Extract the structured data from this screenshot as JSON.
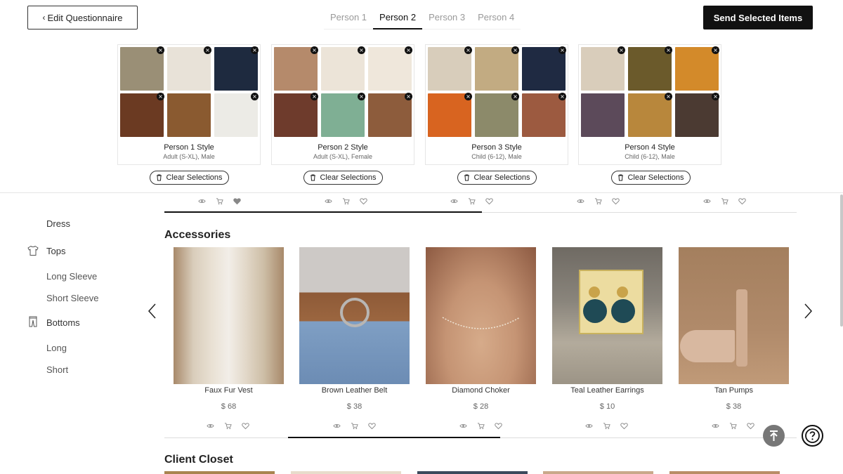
{
  "header": {
    "edit_label": "Edit Questionnaire",
    "send_label": "Send Selected Items",
    "tabs": [
      "Person 1",
      "Person 2",
      "Person 3",
      "Person 4"
    ],
    "active_tab": "Person 2"
  },
  "persons": [
    {
      "title": "Person 1 Style",
      "subtitle": "Adult (S-XL), Male",
      "clear_label": "Clear Selections",
      "thumbs": [
        "#9a8f76",
        "#e8e2d8",
        "#1e2a3f",
        "#6b3a22",
        "#8a5a30",
        "#ecebe6"
      ]
    },
    {
      "title": "Person 2 Style",
      "subtitle": "Adult (S-XL), Female",
      "clear_label": "Clear Selections",
      "thumbs": [
        "#b58a6b",
        "#ece4d8",
        "#efe7db",
        "#6e3b2c",
        "#7faf94",
        "#8d5c3c"
      ]
    },
    {
      "title": "Person 3 Style",
      "subtitle": "Child (6-12), Male",
      "clear_label": "Clear Selections",
      "thumbs": [
        "#d8cdbb",
        "#c2ab82",
        "#1f2a42",
        "#d86420",
        "#8c8a6a",
        "#9c5a40"
      ]
    },
    {
      "title": "Person 4 Style",
      "subtitle": "Child (6-12), Male",
      "clear_label": "Clear Selections",
      "thumbs": [
        "#d9cdbb",
        "#6b5a2b",
        "#d38a2a",
        "#5c4a5a",
        "#b8873c",
        "#4b3a32"
      ]
    }
  ],
  "sidebar": {
    "dress": "Dress",
    "tops": "Tops",
    "long_sleeve": "Long Sleeve",
    "short_sleeve": "Short Sleeve",
    "bottoms": "Bottoms",
    "long": "Long",
    "short": "Short"
  },
  "accessories": {
    "title": "Accessories",
    "items": [
      {
        "name": "Faux Fur Vest",
        "price": "$ 68",
        "color": "#c9b8a0"
      },
      {
        "name": "Brown Leather Belt",
        "price": "$ 38",
        "color": "#6f8fb6"
      },
      {
        "name": "Diamond Choker",
        "price": "$ 28",
        "color": "#c99a7a"
      },
      {
        "name": "Teal Leather Earrings",
        "price": "$ 10",
        "color": "#8b8f86"
      },
      {
        "name": "Tan Pumps",
        "price": "$ 38",
        "color": "#b08a6a"
      }
    ]
  },
  "client_closet": {
    "title": "Client Closet"
  },
  "icons": [
    "eye-icon",
    "cart-icon",
    "heart-icon",
    "trash-icon",
    "shirt-icon",
    "pants-icon",
    "chevron-left-icon",
    "chevron-right-icon",
    "scroll-top-icon",
    "help-icon"
  ]
}
